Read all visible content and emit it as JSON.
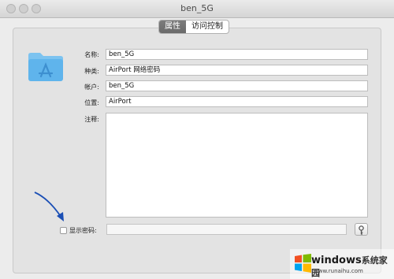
{
  "window": {
    "title": "ben_5G"
  },
  "tabs": [
    {
      "label": "属性",
      "active": true
    },
    {
      "label": "访问控制",
      "active": false
    }
  ],
  "fields": {
    "name": {
      "label": "名称:",
      "value": "ben_5G"
    },
    "kind": {
      "label": "种类:",
      "value": "AirPort 网络密码"
    },
    "account": {
      "label": "帐户:",
      "value": "ben_5G"
    },
    "location": {
      "label": "位置:",
      "value": "AirPort"
    },
    "comments": {
      "label": "注释:",
      "value": ""
    }
  },
  "show_password": {
    "label": "显示密码:",
    "checked": false,
    "value": ""
  },
  "watermark": {
    "brand": "windows",
    "brand_cn": "系统家园",
    "url": "www.runaihu.com"
  },
  "colors": {
    "folder": "#5fb4ec",
    "arrow": "#1b4fb5",
    "active_tab": "#6f6f6f"
  }
}
